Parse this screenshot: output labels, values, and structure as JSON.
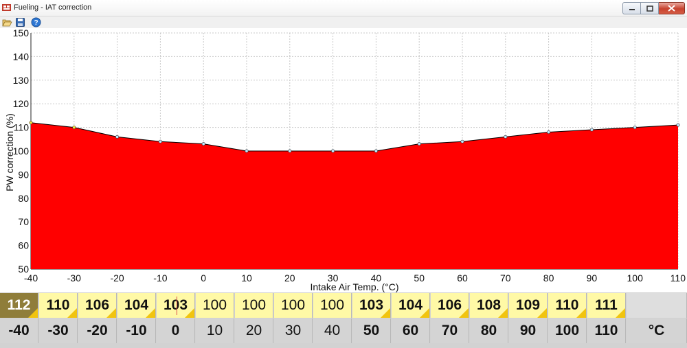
{
  "window": {
    "title": "Fueling - IAT correction",
    "icons": {
      "app": "fuel-map-icon",
      "minimize": "minimize-icon",
      "maximize": "maximize-icon",
      "close": "close-icon"
    }
  },
  "toolbar": {
    "icons": [
      "open-folder-icon",
      "save-icon",
      "help-icon"
    ]
  },
  "colors": {
    "fill": "#ff0000",
    "line": "#000000",
    "value_cell": "#fff9a6",
    "selected_cell": "#8f7d3a",
    "corner_marker": "#f1c40f"
  },
  "chart_data": {
    "type": "area",
    "x": [
      -40,
      -30,
      -20,
      -10,
      0,
      10,
      20,
      30,
      40,
      50,
      60,
      70,
      80,
      90,
      100,
      110
    ],
    "values": [
      112,
      110,
      106,
      104,
      103,
      100,
      100,
      100,
      100,
      103,
      104,
      106,
      108,
      109,
      110,
      111
    ],
    "xlabel": "Intake Air Temp. (°C)",
    "ylabel": "PW correction (%)",
    "xlim": [
      -40,
      110
    ],
    "ylim": [
      50,
      150
    ],
    "xticks": [
      -40,
      -30,
      -20,
      -10,
      0,
      10,
      20,
      30,
      40,
      50,
      60,
      70,
      80,
      90,
      100,
      110
    ],
    "yticks": [
      50,
      60,
      70,
      80,
      90,
      100,
      110,
      120,
      130,
      140,
      150
    ],
    "grid": true
  },
  "table": {
    "values": [
      "112",
      "110",
      "106",
      "104",
      "103",
      "100",
      "100",
      "100",
      "100",
      "103",
      "104",
      "106",
      "108",
      "109",
      "110",
      "111"
    ],
    "temps": [
      "-40",
      "-30",
      "-20",
      "-10",
      "0",
      "10",
      "20",
      "30",
      "40",
      "50",
      "60",
      "70",
      "80",
      "90",
      "100",
      "110"
    ],
    "unit": "°C"
  }
}
